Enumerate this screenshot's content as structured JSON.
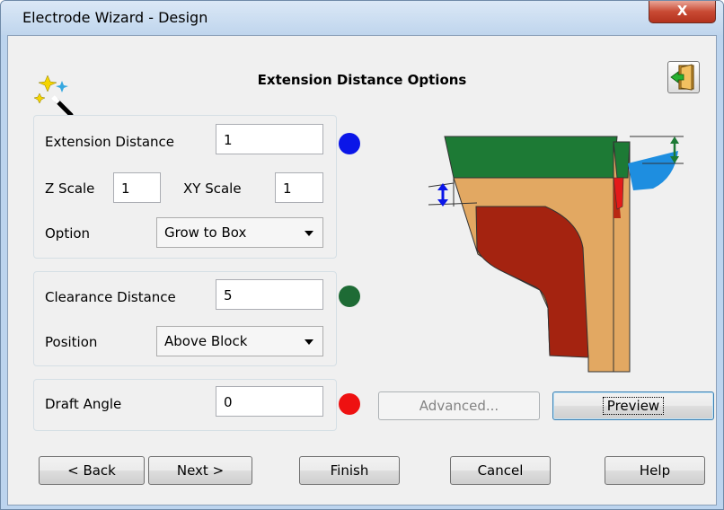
{
  "window": {
    "title": "Electrode Wizard - Design",
    "close_label": "X"
  },
  "page": {
    "heading": "Extension Distance Options"
  },
  "extension": {
    "distance_label": "Extension Distance",
    "distance_value": "1",
    "z_scale_label": "Z Scale",
    "z_scale_value": "1",
    "xy_scale_label": "XY Scale",
    "xy_scale_value": "1",
    "option_label": "Option",
    "option_value": "Grow to Box",
    "indicator_color": "#0b16e8"
  },
  "clearance": {
    "distance_label": "Clearance Distance",
    "distance_value": "5",
    "position_label": "Position",
    "position_value": "Above Block",
    "indicator_color": "#1e6b35"
  },
  "draft": {
    "angle_label": "Draft Angle",
    "angle_value": "0",
    "indicator_color": "#ee1111"
  },
  "actions": {
    "advanced_label": "Advanced...",
    "preview_label": "Preview"
  },
  "footer": {
    "back_label": "< Back",
    "next_label": "Next >",
    "finish_label": "Finish",
    "cancel_label": "Cancel",
    "help_label": "Help"
  },
  "icons": {
    "wizard": "magic-wand-icon",
    "exit": "exit-door-icon"
  }
}
